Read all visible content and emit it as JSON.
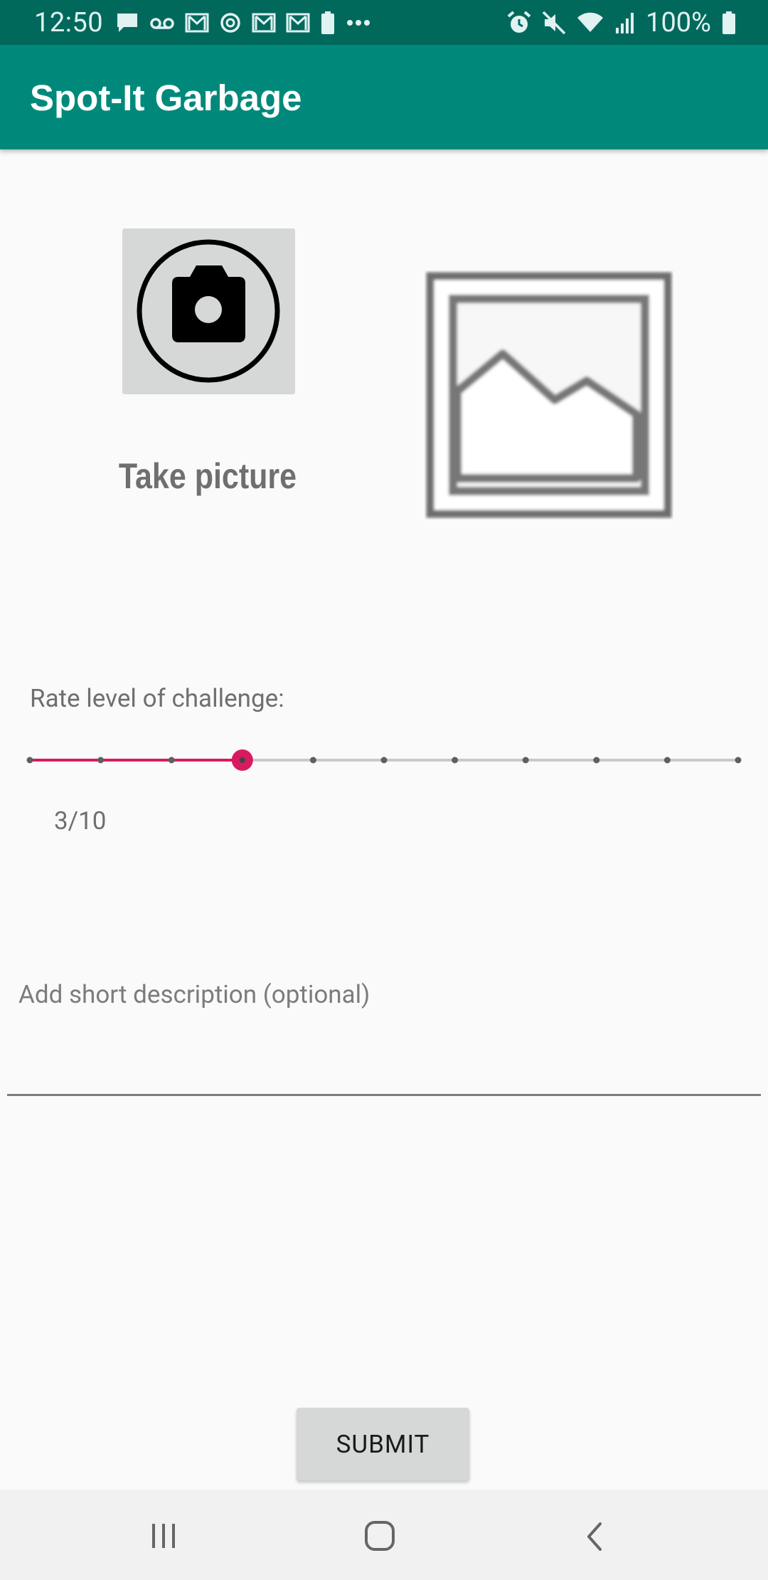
{
  "status_bar": {
    "time": "12:50",
    "battery": "100%",
    "left_icons": [
      "message-icon",
      "voicemail-icon",
      "gmail-icon",
      "sync-icon",
      "gmail-icon",
      "gmail-icon",
      "battery-saver-icon",
      "more-dots-icon"
    ],
    "right_icons": [
      "alarm-icon",
      "mute-icon",
      "wifi-icon",
      "signal-icon",
      "battery-icon"
    ]
  },
  "app_bar": {
    "title": "Spot-It Garbage"
  },
  "capture": {
    "take_picture_label": "Take picture",
    "camera_icon": "camera-icon",
    "preview_icon": "image-placeholder-icon"
  },
  "rating": {
    "label": "Rate level of challenge:",
    "value_text": "3/10",
    "value": 3,
    "max": 10,
    "accent_color": "#d81b60"
  },
  "description": {
    "placeholder": "Add short description (optional)",
    "value": ""
  },
  "actions": {
    "submit_label": "SUBMIT"
  },
  "nav_bar": {
    "recents_icon": "recents-icon",
    "home_icon": "home-icon",
    "back_icon": "back-icon"
  },
  "colors": {
    "status_bar": "#00695c",
    "app_bar": "#00897b",
    "background": "#fafafa"
  }
}
